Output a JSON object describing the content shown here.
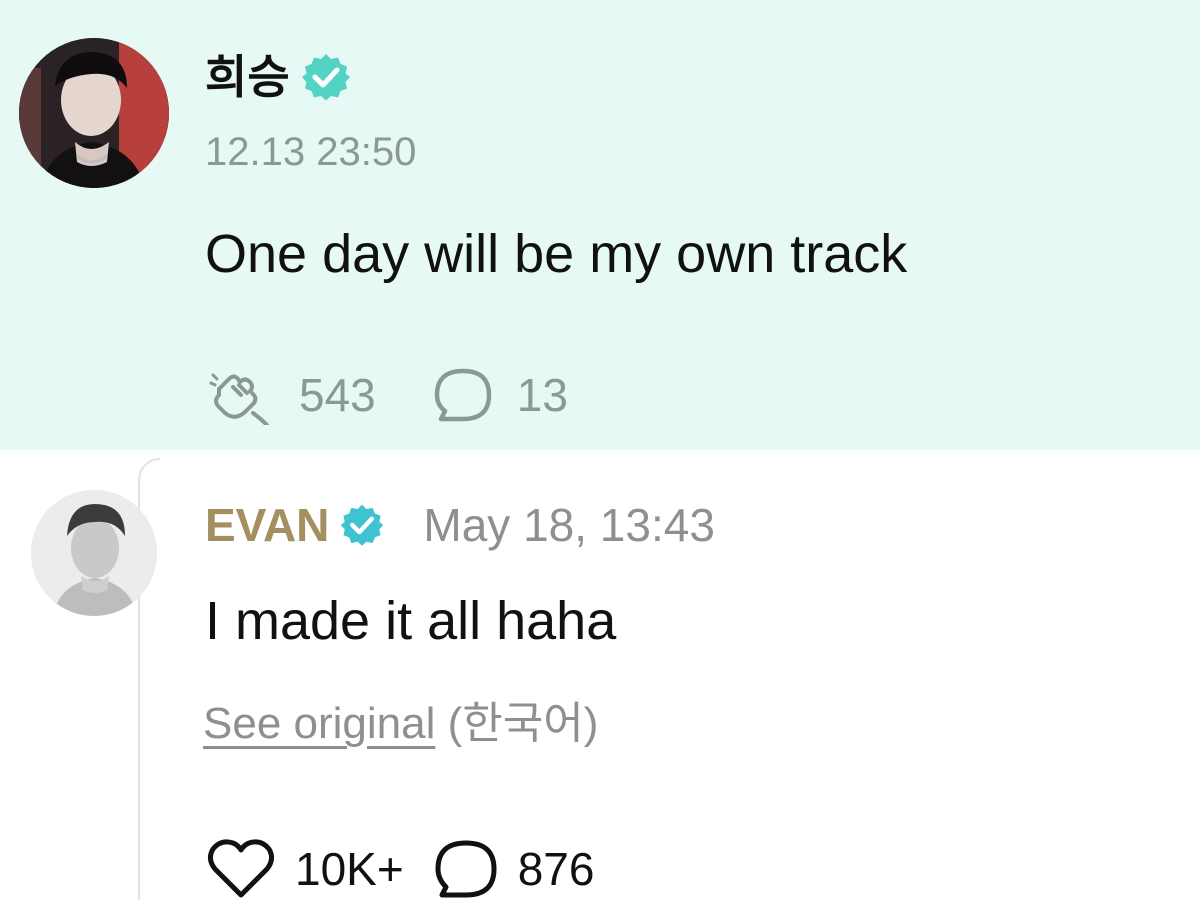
{
  "post": {
    "author": {
      "name": "희승",
      "verified": true,
      "avatar": "profile-photo-dark"
    },
    "timestamp": "12.13 23:50",
    "text": "One day will be my own track",
    "reactions": {
      "icon": "cheer-hand-icon",
      "count": "543"
    },
    "comments": {
      "icon": "speech-bubble-icon",
      "count": "13"
    },
    "colors": {
      "background": "#e6f9f4",
      "badge": "#53d3c4",
      "meta": "#8c9893"
    }
  },
  "reply": {
    "author": {
      "name": "EVAN",
      "verified": true,
      "avatar": "profile-photo-grayscale"
    },
    "timestamp": "May 18, 13:43",
    "text": "I made it all haha",
    "translation": {
      "link_label": "See original",
      "language": "(한국어)"
    },
    "likes": {
      "icon": "heart-icon",
      "count": "10K+"
    },
    "comments": {
      "icon": "speech-bubble-icon",
      "count": "876"
    },
    "colors": {
      "author_name": "#a58f61",
      "meta": "#8f8f8f"
    }
  }
}
